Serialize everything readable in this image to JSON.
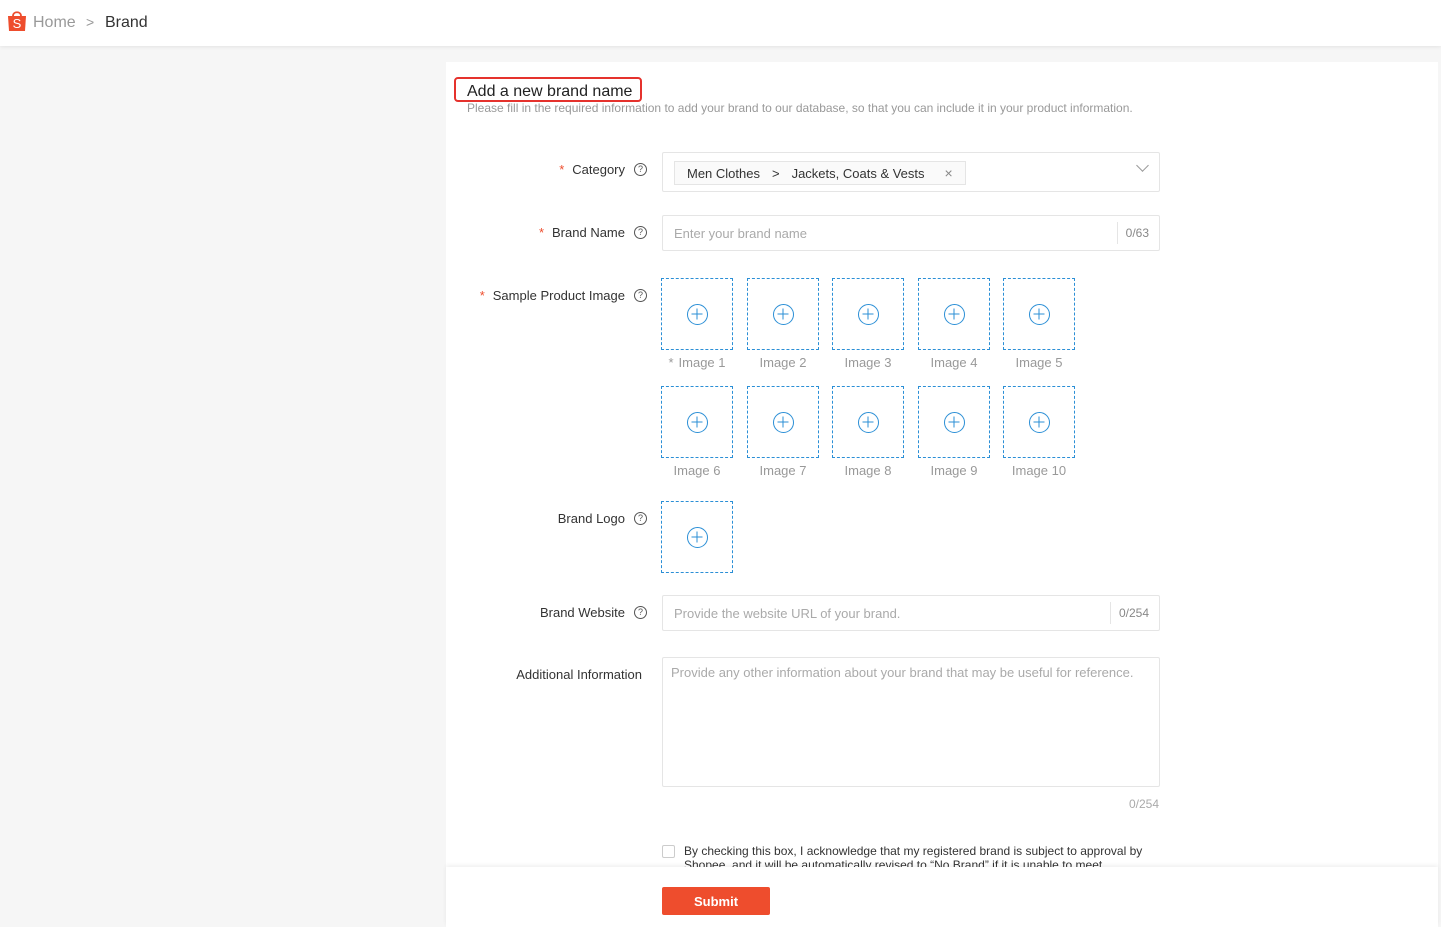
{
  "breadcrumb": {
    "home": "Home",
    "separator": ">",
    "current": "Brand"
  },
  "header": {
    "title": "Add a new brand name",
    "subtitle": "Please fill in the required information to add your brand to our database, so that you can include it in your product information."
  },
  "form": {
    "category": {
      "label": "Category",
      "required_mark": "*",
      "chip_parent": "Men Clothes",
      "chip_sep": ">",
      "chip_child": "Jackets, Coats & Vests",
      "chip_close": "×"
    },
    "brand_name": {
      "label": "Brand Name",
      "required_mark": "*",
      "placeholder": "Enter your brand name",
      "counter": "0/63"
    },
    "sample_images": {
      "label": "Sample Product Image",
      "required_mark": "*",
      "items": [
        {
          "label": "Image 1",
          "required": true
        },
        {
          "label": "Image 2"
        },
        {
          "label": "Image 3"
        },
        {
          "label": "Image 4"
        },
        {
          "label": "Image 5"
        },
        {
          "label": "Image 6"
        },
        {
          "label": "Image 7"
        },
        {
          "label": "Image 8"
        },
        {
          "label": "Image 9"
        },
        {
          "label": "Image 10"
        }
      ]
    },
    "brand_logo": {
      "label": "Brand Logo"
    },
    "brand_website": {
      "label": "Brand Website",
      "placeholder": "Provide the website URL of your brand.",
      "counter": "0/254"
    },
    "additional_info": {
      "label": "Additional Information",
      "placeholder": "Provide any other information about your brand that may be useful for reference.",
      "counter": "0/254"
    },
    "agreement": "By checking this box, I acknowledge that my registered brand is subject to approval by Shopee, and it will be automatically revised to “No Brand” if it is unable to meet",
    "submit_label": "Submit"
  },
  "colors": {
    "accent": "#ee4d2d",
    "upload_border": "#2b8fd6",
    "highlight": "#e5322d"
  },
  "icons": {
    "logo": "shopee-bag-icon",
    "help": "question-circle-icon",
    "upload": "plus-circle-icon"
  }
}
